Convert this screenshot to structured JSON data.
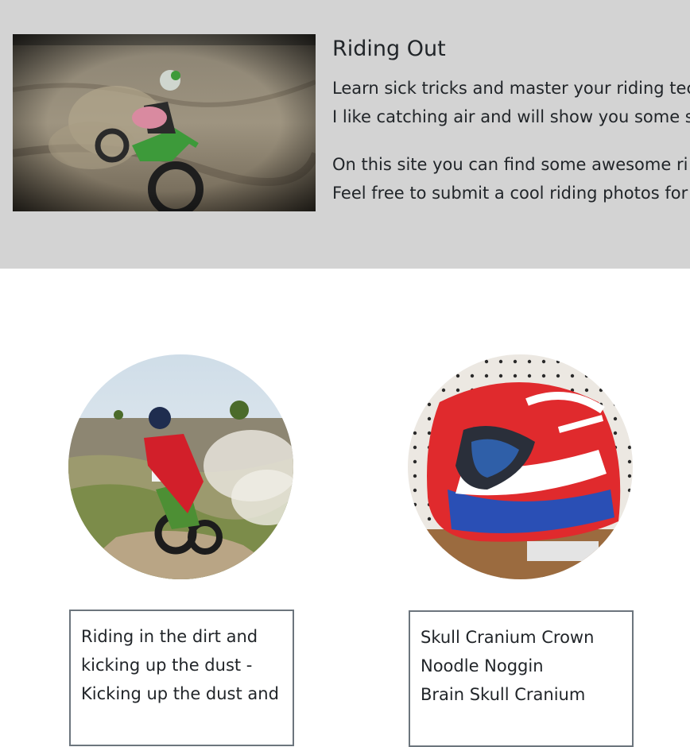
{
  "hero": {
    "title": "Riding Out",
    "paragraph1": [
      "Learn sick tricks and master your riding tec",
      "I like catching air and will show you some s"
    ],
    "paragraph2": [
      "On this site you can find some awesome ri",
      "Feel free to submit a cool riding photos for"
    ]
  },
  "cards": [
    {
      "caption_lines": [
        "Riding in the dirt and",
        "kicking up the dust -",
        "Kicking up the dust and"
      ]
    },
    {
      "caption_lines": [
        "Skull Cranium Crown",
        "Noodle Noggin",
        "Brain Skull Cranium"
      ]
    }
  ],
  "colors": {
    "hero_background": "#d3d3d3",
    "caption_border": "#6c757d",
    "text": "#212529"
  }
}
